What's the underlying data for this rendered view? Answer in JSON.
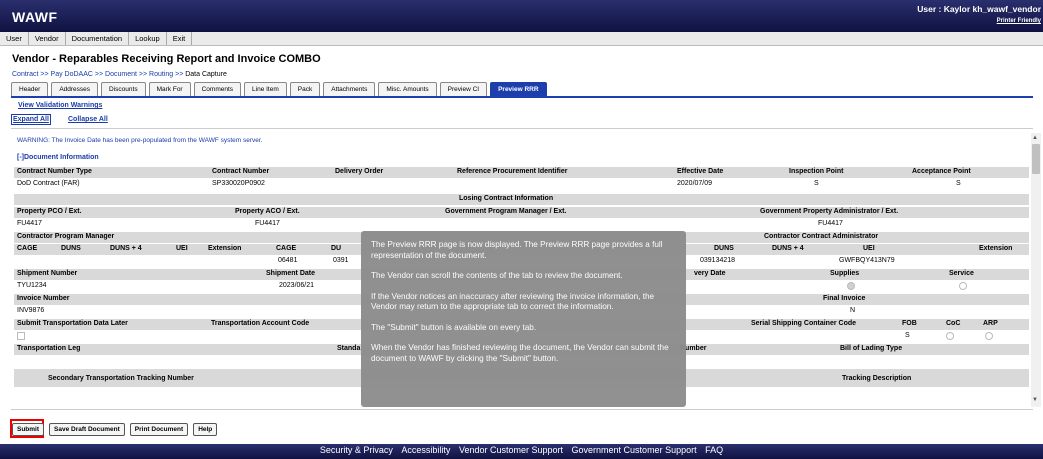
{
  "header": {
    "logo": "WAWF",
    "user": "User : Kaylor kh_wawf_vendor",
    "printer_friendly": "Printer Friendly"
  },
  "menu": [
    "User",
    "Vendor",
    "Documentation",
    "Lookup",
    "Exit"
  ],
  "page_title": "Vendor - Reparables Receiving Report and Invoice COMBO",
  "breadcrumb": {
    "contract": "Contract",
    "pay": "Pay DoDAAC",
    "document": "Document",
    "routing": "Routing",
    "current": "Data Capture",
    "sep": " >> "
  },
  "tabs": [
    "Header",
    "Addresses",
    "Discounts",
    "Mark For",
    "Comments",
    "Line Item",
    "Pack",
    "Attachments",
    "Misc. Amounts",
    "Preview CI",
    "Preview RRR"
  ],
  "active_tab": "Preview RRR",
  "view_validation": "View Validation Warnings",
  "expand_all": "Expand All",
  "collapse_all": "Collapse All",
  "warning": "WARNING: The Invoice Date has been pre-populated from the WAWF system server.",
  "doc_info": "[-]Document Information",
  "doc": {
    "h": {
      "contract_number_type": "Contract Number Type",
      "contract_number": "Contract Number",
      "delivery_order": "Delivery Order",
      "ref_proc_id": "Reference Procurement Identifier",
      "effective_date": "Effective Date",
      "inspection_point": "Inspection Point",
      "acceptance_point": "Acceptance Point"
    },
    "v": {
      "contract_number_type": "DoD Contract (FAR)",
      "contract_number": "SP330020P0902",
      "effective_date": "2020/07/09",
      "inspection_point": "S",
      "acceptance_point": "S"
    },
    "losing": "Losing Contract Information",
    "h2": {
      "property_pco": "Property PCO / Ext.",
      "property_aco": "Property ACO / Ext.",
      "gpm": "Government Program Manager / Ext.",
      "gpa": "Government Property Administrator / Ext."
    },
    "v2": {
      "property_pco": "FU4417",
      "property_aco": "FU4417",
      "gpa": "FU4417"
    },
    "h3": {
      "cpm": "Contractor Program Manager",
      "cca": "Contractor Contract Administrator"
    },
    "h4": {
      "cage": "CAGE",
      "duns": "DUNS",
      "duns4": "DUNS + 4",
      "uei": "UEI",
      "extension": "Extension",
      "cage2": "CAGE",
      "du2": "DU",
      "duns3": "DUNS",
      "duns4_3": "DUNS + 4",
      "uei3": "UEI",
      "extension3": "Extension"
    },
    "v4": {
      "cage2": "06481",
      "du2": "0391",
      "duns3": "039134218",
      "uei3": "GWFBQY413N79"
    },
    "h5": {
      "shipment_number": "Shipment Number",
      "shipment_date": "Shipment Date",
      "delivery_date": "very Date",
      "supplies": "Supplies",
      "service": "Service"
    },
    "v5": {
      "shipment_number": "TYU1234",
      "shipment_date": "2023/06/21"
    },
    "h6": {
      "invoice_number": "Invoice Number",
      "final_invoice": "Final Invoice"
    },
    "v6": {
      "invoice_number": "INV9876",
      "final_invoice": "N"
    },
    "h7": {
      "submit_later": "Submit Transportation Data Later",
      "tac": "Transportation Account Code",
      "sscc": "Serial Shipping Container Code",
      "fob": "FOB",
      "coc": "CoC",
      "arp": "ARP"
    },
    "v7": {
      "fob": "S"
    },
    "h8": {
      "transportation_leg": "Transportation Leg",
      "standa": "Standa",
      "umber": "Number",
      "bol_type": "Bill of Lading Type"
    },
    "h9": {
      "sttn": "Secondary Transportation Tracking Number",
      "tracking_description": "Tracking Description"
    }
  },
  "tooltip": [
    "The Preview RRR page is now displayed. The Preview RRR page provides a full representation of the document.",
    "The Vendor can scroll the contents of the tab to review the document.",
    "If the Vendor notices an inaccuracy after reviewing the invoice information, the Vendor may return to the appropriate tab to correct the information.",
    "The \"Submit\" button is available on every tab.",
    "When the Vendor has finished reviewing the document, the Vendor can submit the document to WAWF by clicking the \"Submit\" button."
  ],
  "buttons": {
    "submit": "Submit",
    "save_draft": "Save Draft Document",
    "print": "Print Document",
    "help": "Help"
  },
  "footer_links": [
    "Security & Privacy",
    "Accessibility",
    "Vendor Customer Support",
    "Government Customer Support",
    "FAQ"
  ],
  "colors": {
    "accent": "#1d3fae",
    "highlight": "#e00000",
    "bar": "#1a1f5a"
  }
}
